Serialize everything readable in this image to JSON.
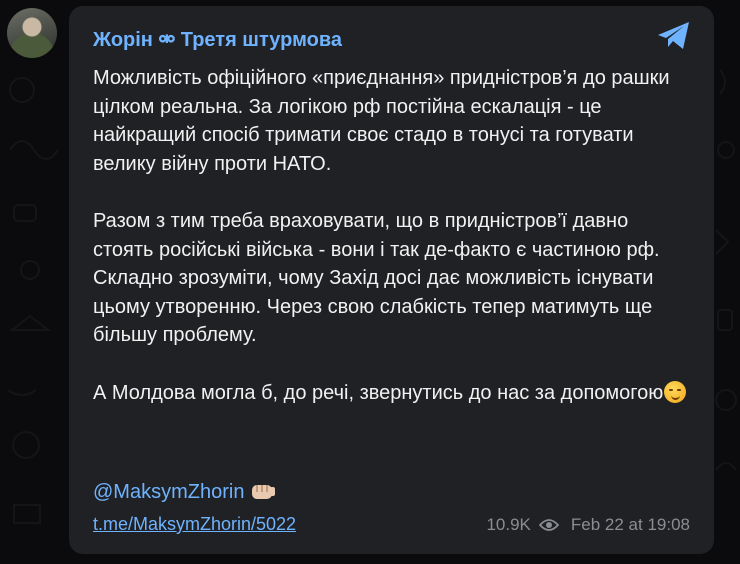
{
  "channel": {
    "name": "Жорін ⚮ Третя штурмова",
    "avatar_icon": "soldier-avatar"
  },
  "post": {
    "paragraphs": [
      "Можливість офіційного «приєднання» придністров’я до рашки цілком реальна. За логікою рф постійна ескалація - це найкращий спосіб тримати своє стадо в тонусі та готувати велику війну проти НАТО.",
      "Разом з тим треба враховувати, що в придністров’ї давно стоять російські війська - вони і так де-факто є частиною рф. Складно зрозуміти, чому Захід досі дає можливість існувати цьому утворенню. Через свою слабкість тепер матимуть ще більшу проблему.",
      "А Молдова могла б, до речі, звернутись до нас за допомогою"
    ],
    "emoji": "smirk-emoji",
    "mention": "@MaksymZhorin",
    "mention_emoji": "fist-emoji",
    "link": "t.me/MaksymZhorin/5022",
    "views": "10.9K",
    "views_icon": "eye-icon",
    "date": "Feb 22 at 19:08"
  },
  "colors": {
    "background": "#0b0b0d",
    "bubble": "#202124",
    "accent": "#6fb3ff",
    "text": "#f1f1f1",
    "meta": "#8a8d91"
  }
}
